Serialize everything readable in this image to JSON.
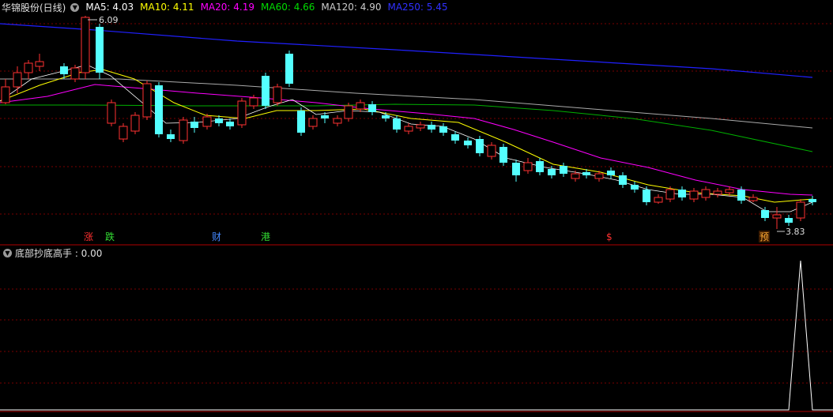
{
  "header": {
    "stock_name": "华锦股份(日线)",
    "ma5": "MA5: 4.03",
    "ma10": "MA10: 4.11",
    "ma20": "MA20: 4.19",
    "ma60": "MA60: 4.66",
    "ma120": "MA120: 4.90",
    "ma250": "MA250: 5.45"
  },
  "main_chart": {
    "high_label": "6.09",
    "low_label": "3.83",
    "event_tags": [
      {
        "text": "涨",
        "color": "#ff3030"
      },
      {
        "text": "跌",
        "color": "#33dd33"
      },
      {
        "text": "财",
        "color": "#4488ff"
      },
      {
        "text": "港",
        "color": "#33dd33"
      },
      {
        "text": "$",
        "color": "#ff3030"
      },
      {
        "text": "预",
        "color": "#ffaa33"
      }
    ]
  },
  "indicator": {
    "title": "底部抄底高手 : 0.00"
  },
  "colors": {
    "up": "#ff3232",
    "down": "#54ffff",
    "ma5": "#ffffff",
    "ma10": "#ffff00",
    "ma20": "#ff00ff",
    "ma60": "#00cc00",
    "ma120": "#bbbbbb",
    "ma250": "#2020ff",
    "grid": "#8b0000"
  }
}
